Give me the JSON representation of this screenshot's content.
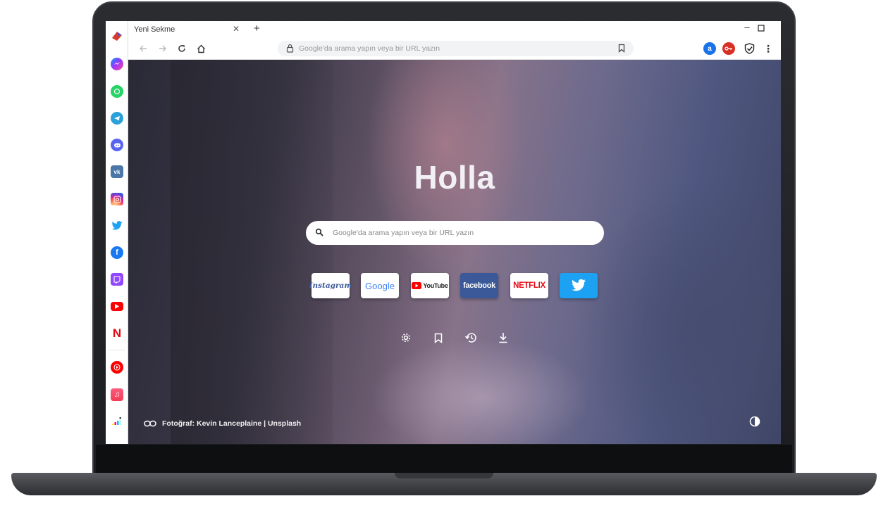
{
  "browser": {
    "tab_title": "Yeni Sekme",
    "omnibox_placeholder": "Google'da arama yapın veya bir URL yazın"
  },
  "sidebar": {
    "items": [
      {
        "name": "logo",
        "color": "#d33b2a"
      },
      {
        "name": "messenger",
        "color": "#a64bf4"
      },
      {
        "name": "whatsapp",
        "color": "#25d366"
      },
      {
        "name": "telegram",
        "color": "#2aa1da"
      },
      {
        "name": "discord",
        "color": "#5865f2"
      },
      {
        "name": "vk",
        "color": "#4a76a8"
      },
      {
        "name": "instagram",
        "color": "#d6249f"
      },
      {
        "name": "twitter",
        "color": "#1da1f2"
      },
      {
        "name": "facebook",
        "color": "#1877f2"
      },
      {
        "name": "twitch",
        "color": "#9146ff"
      },
      {
        "name": "youtube",
        "color": "#ff0000"
      },
      {
        "name": "netflix",
        "color": "#e50914"
      },
      {
        "name": "youtube-music",
        "color": "#ff0000"
      },
      {
        "name": "apple-music",
        "color": "#fa3355"
      },
      {
        "name": "deezer",
        "color": "#00c7f2"
      }
    ]
  },
  "newtab": {
    "headline": "Holla",
    "search_placeholder": "Google'da arama yapın veya bir URL yazın",
    "tiles": [
      {
        "label": "Instagram",
        "text_color": "#3b5998",
        "bg": "#ffffff"
      },
      {
        "label": "Google",
        "text_color": "#4285f4",
        "bg": "#ffffff"
      },
      {
        "label": "YouTube",
        "text_color": "#222222",
        "bg": "#ffffff"
      },
      {
        "label": "facebook",
        "text_color": "#ffffff",
        "bg": "#3b5998"
      },
      {
        "label": "NETFLIX",
        "text_color": "#e50914",
        "bg": "#ffffff"
      },
      {
        "label": "",
        "text_color": "#ffffff",
        "bg": "#1da1f2"
      }
    ],
    "photo_credit": "Fotoğraf: Kevin Lanceplaine | Unsplash"
  }
}
